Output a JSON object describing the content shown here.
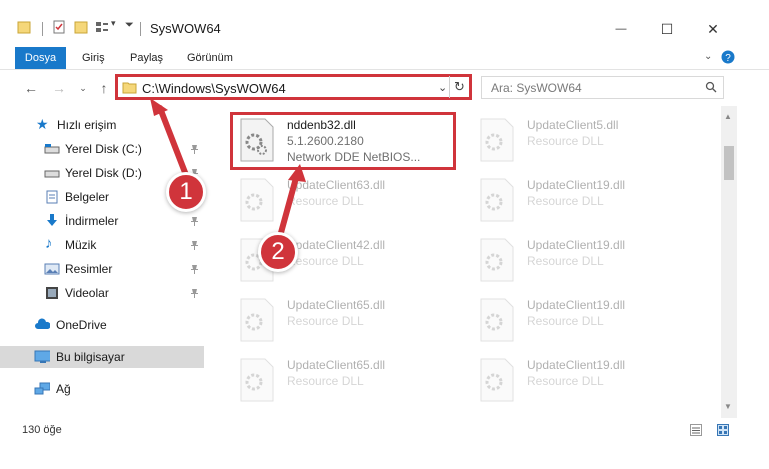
{
  "window": {
    "title": "SysWOW64",
    "controls": {
      "minimize": "—",
      "maximize": "☐",
      "close": "✕"
    }
  },
  "ribbon": {
    "tabs": [
      "Dosya",
      "Giriş",
      "Paylaş",
      "Görünüm"
    ]
  },
  "address": {
    "path": "C:\\Windows\\SysWOW64"
  },
  "search": {
    "placeholder": "Ara: SysWOW64"
  },
  "nav": {
    "items": [
      {
        "label": "Hızlı erişim",
        "icon": "star-icon",
        "pinned": false
      },
      {
        "label": "Yerel Disk (C:)",
        "icon": "drive-icon",
        "pinned": true
      },
      {
        "label": "Yerel Disk (D:)",
        "icon": "drive-icon",
        "pinned": true
      },
      {
        "label": "Belgeler",
        "icon": "documents-icon",
        "pinned": true
      },
      {
        "label": "İndirmeler",
        "icon": "download-icon",
        "pinned": true
      },
      {
        "label": "Müzik",
        "icon": "music-icon",
        "pinned": true
      },
      {
        "label": "Resimler",
        "icon": "pictures-icon",
        "pinned": true
      },
      {
        "label": "Videolar",
        "icon": "video-icon",
        "pinned": true
      },
      {
        "label": "OneDrive",
        "icon": "cloud-icon",
        "pinned": false
      },
      {
        "label": "Bu bilgisayar",
        "icon": "computer-icon",
        "pinned": false
      },
      {
        "label": "Ağ",
        "icon": "network-icon",
        "pinned": false
      }
    ]
  },
  "files": [
    {
      "name": "nddenb32.dll",
      "line2": "5.1.2600.2180",
      "line3": "Network DDE NetBIOS..."
    },
    {
      "name": "UpdateClient5.dll",
      "line2": "Resource DLL"
    },
    {
      "name": "UpdateClient63.dll",
      "line2": "Resource DLL"
    },
    {
      "name": "UpdateClient19.dll",
      "line2": "Resource DLL"
    },
    {
      "name": "UpdateClient42.dll",
      "line2": "Resource DLL"
    },
    {
      "name": "UpdateClient19.dll",
      "line2": "Resource DLL"
    },
    {
      "name": "UpdateClient65.dll",
      "line2": "Resource DLL"
    },
    {
      "name": "UpdateClient19.dll",
      "line2": "Resource DLL"
    },
    {
      "name": "UpdateClient65.dll",
      "line2": "Resource DLL"
    },
    {
      "name": "UpdateClient19.dll",
      "line2": "Resource DLL"
    }
  ],
  "status": {
    "count": "130 öğe"
  },
  "callouts": [
    "1",
    "2"
  ],
  "colors": {
    "accent": "#1979ca",
    "highlight": "#d0343b",
    "selected": "#d9d9d9"
  }
}
